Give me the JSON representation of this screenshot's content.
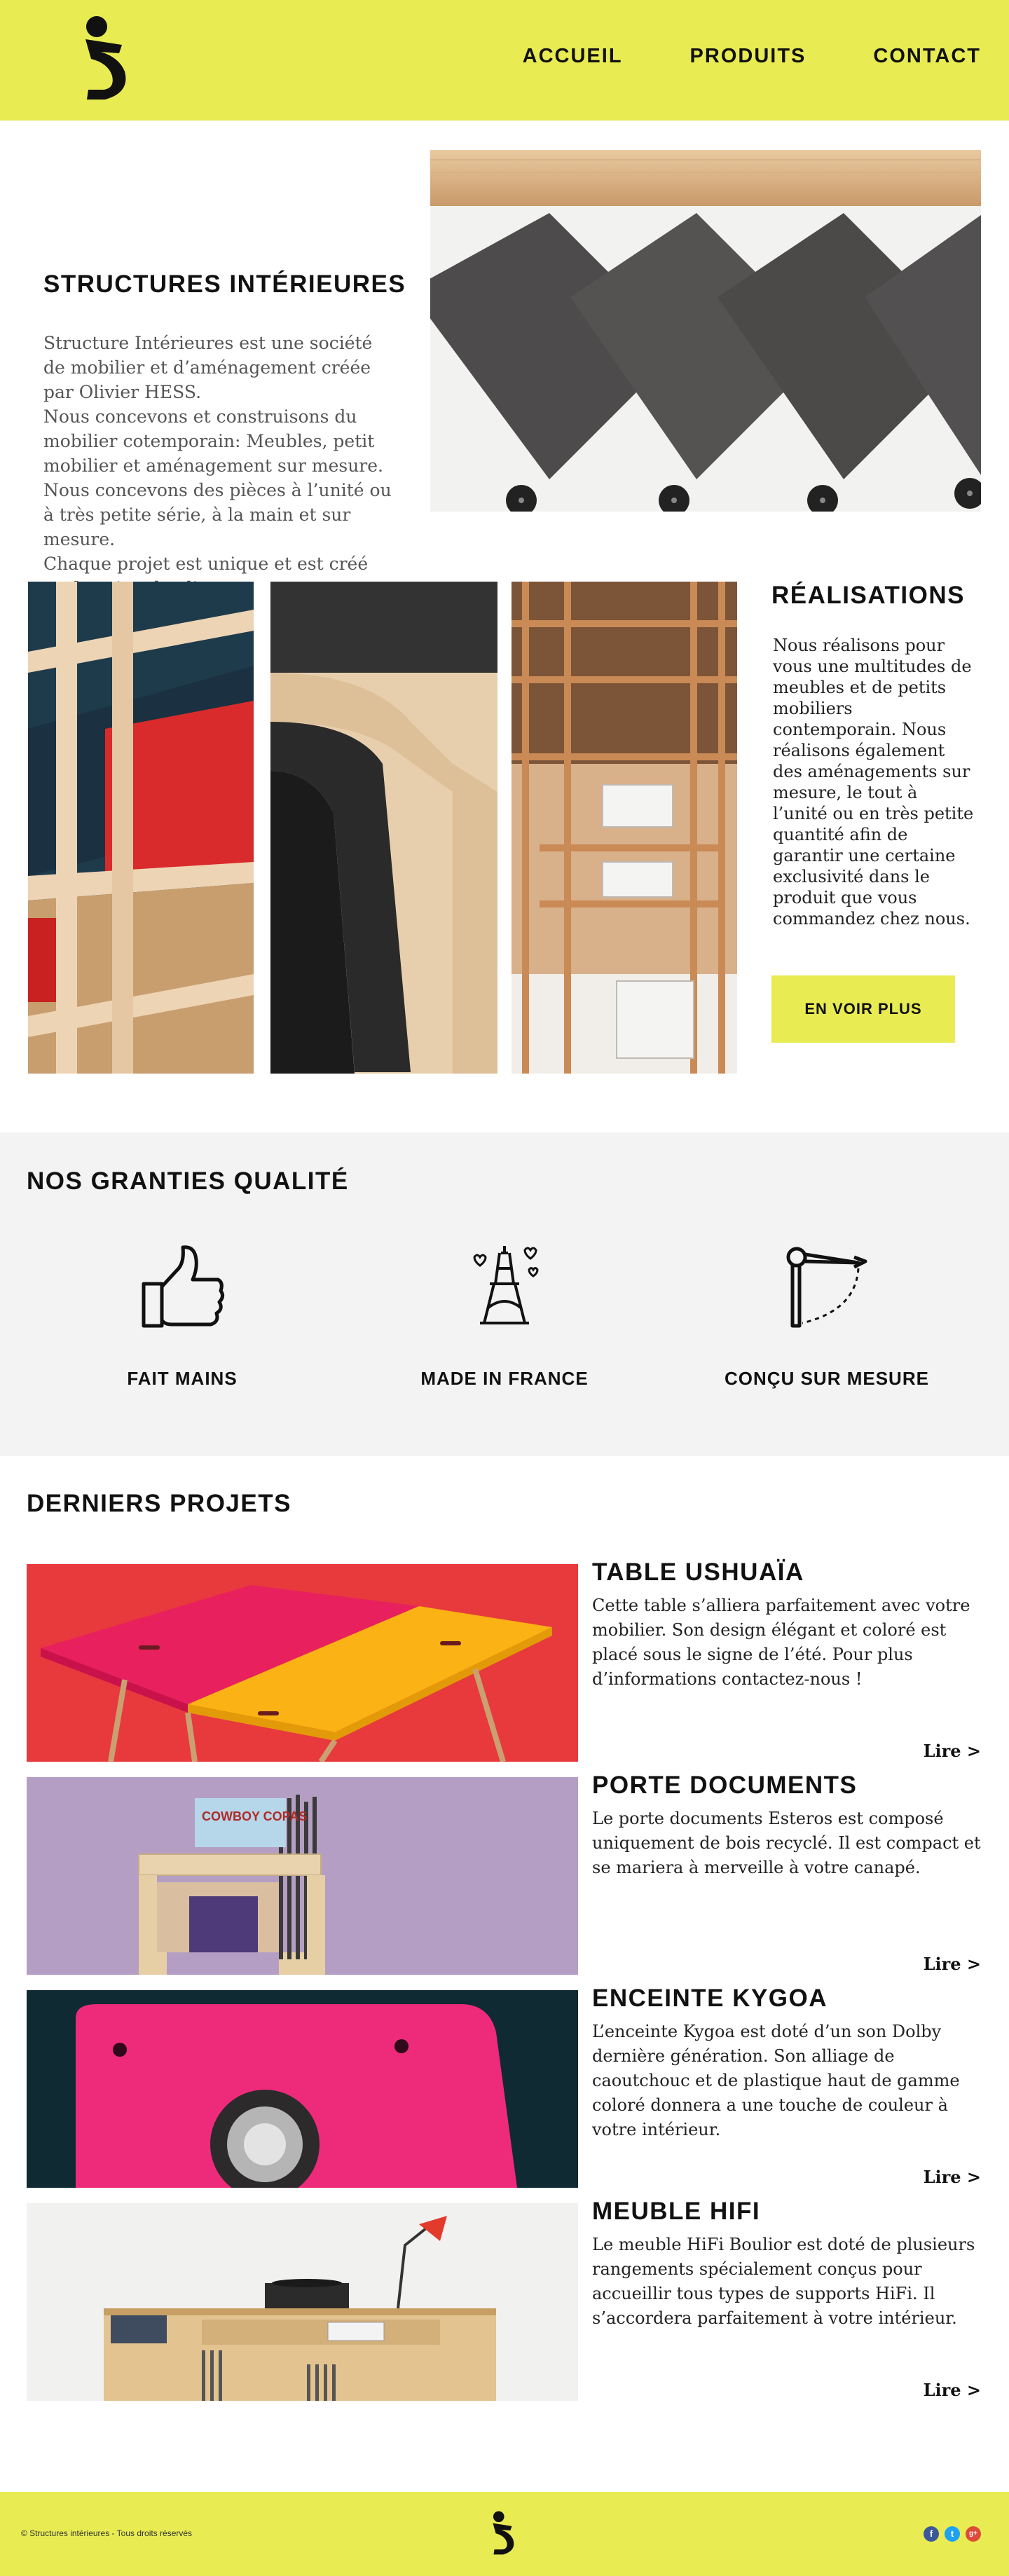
{
  "header": {
    "nav": [
      "ACCUEIL",
      "PRODUITS",
      "CONTACT"
    ]
  },
  "intro": {
    "title": "STRUCTURES INTÉRIEURES",
    "paragraphs": [
      "Structure Intérieures est une société de mobilier et d’aménagement créée par Olivier HESS.",
      "Nous concevons et construisons du mobilier cotemporain: Meubles, petit mobilier et aménagement sur mesure.",
      "Nous concevons des pièces à l’unité ou à très petite série, à la main et sur mesure.",
      "Chaque projet est unique et est créé en fonction du client."
    ]
  },
  "realisations": {
    "title": "RÉALISATIONS",
    "description": "Nous réalisons pour vous une multitudes de meubles et de petits mobiliers contemporain. Nous réalisons également des aménagements sur mesure, le tout à l’unité ou en très petite quantité afin de garantir une certaine exclusivité dans le produit que vous commandez chez nous.",
    "button": "EN VOIR PLUS"
  },
  "garanties": {
    "title": "NOS GRANTIES QUALITÉ",
    "items": [
      {
        "label": "FAIT MAINS",
        "icon": "thumbs-up-icon"
      },
      {
        "label": "MADE IN FRANCE",
        "icon": "eiffel-tower-icon"
      },
      {
        "label": "CONÇU SUR MESURE",
        "icon": "compass-icon"
      }
    ]
  },
  "projets": {
    "title": "DERNIERS PROJETS",
    "read_more": "Lire >",
    "items": [
      {
        "title": "TABLE USHUAÏA",
        "text": "Cette table s’alliera parfaitement avec votre mobilier. Son design élégant et coloré est placé sous le signe de l’été. Pour plus d’informations contactez-nous !"
      },
      {
        "title": "PORTE DOCUMENTS",
        "text": "Le porte documents Esteros est composé uniquement de bois recyclé. Il est compact et se mariera à merveille à votre canapé."
      },
      {
        "title": "ENCEINTE KYGOA",
        "text": "L’enceinte Kygoa est doté d’un son Dolby dernière génération. Son alliage de caoutchouc et de plastique haut de gamme coloré donnera a une touche de couleur à votre intérieur."
      },
      {
        "title": "MEUBLE HIFI",
        "text": "Le meuble HiFi Boulior est doté de plusieurs rangements spécialement conçus pour accueillir tous types de supports HiFi. Il s’accordera parfaitement à votre intérieur."
      }
    ],
    "image_label": "COWBOY COPAS"
  },
  "footer": {
    "copyright": "© Structures intérieures - Tous droits réservés",
    "social": [
      "f",
      "t",
      "g+"
    ]
  },
  "colors": {
    "brand_yellow": "#e8ec52",
    "grey_bg": "#f3f3f3"
  }
}
